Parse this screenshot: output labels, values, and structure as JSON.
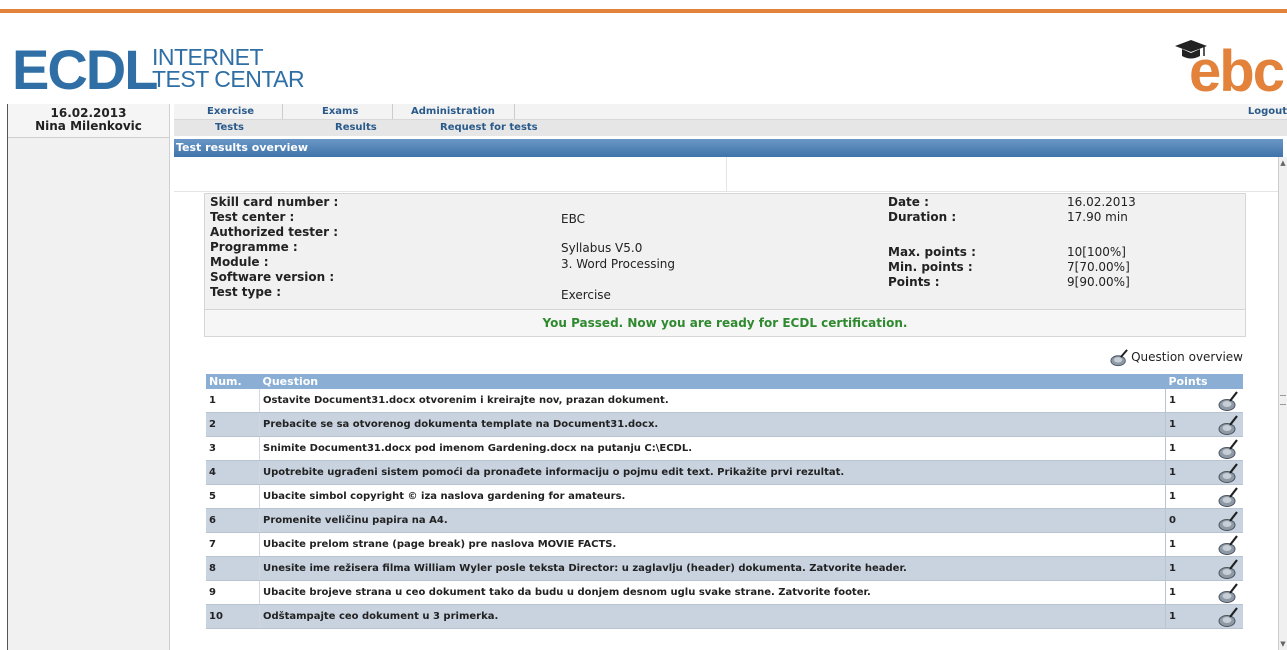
{
  "brand": {
    "left_logo": "ECDL",
    "left_sub1": "INTERNET",
    "left_sub2": "TEST CENTAR",
    "right_logo": "ebc",
    "accent": "#e3823a",
    "blue": "#2f6fa5"
  },
  "sidebar": {
    "date": "16.02.2013",
    "user": "Nina Milenkovic"
  },
  "nav": {
    "row1": [
      "Exercise",
      "Exams",
      "Administration"
    ],
    "logout": "Logout",
    "row2": [
      "Tests",
      "Results",
      "Request for tests"
    ]
  },
  "page_title": "Test results overview",
  "info": {
    "skill_card_label": "Skill card number :",
    "test_center_label": "Test center :",
    "test_center_value": "EBC",
    "authorized_label": "Authorized tester :",
    "programme_label": "Programme :",
    "programme_value": "Syllabus V5.0",
    "module_label": "Module :",
    "module_value": "3. Word Processing",
    "software_label": "Software version :",
    "test_type_label": "Test type :",
    "test_type_value": "Exercise",
    "date_label": "Date :",
    "date_value": "16.02.2013",
    "duration_label": "Duration :",
    "duration_value": "17.90 min",
    "max_label": "Max. points :",
    "max_value": "10[100%]",
    "min_label": "Min. points :",
    "min_value": "7[70.00%]",
    "points_label": "Points :",
    "points_value": "9[90.00%]",
    "passed_message": "You Passed. Now you are ready for ECDL certification."
  },
  "question_overview_label": "Question overview",
  "table": {
    "headers": {
      "num": "Num.",
      "question": "Question",
      "points": "Points"
    },
    "rows": [
      {
        "num": "1",
        "question": "Ostavite Document31.docx otvorenim i kreirajte nov, prazan dokument.",
        "points": "1"
      },
      {
        "num": "2",
        "question": "Prebacite se sa otvorenog dokumenta template na Document31.docx.",
        "points": "1"
      },
      {
        "num": "3",
        "question": "Snimite Document31.docx pod imenom Gardening.docx na putanju C:\\ECDL.",
        "points": "1"
      },
      {
        "num": "4",
        "question": "Upotrebite ugrađeni sistem pomoći da pronađete informaciju o pojmu edit text. Prikažite prvi rezultat.",
        "points": "1"
      },
      {
        "num": "5",
        "question": "Ubacite simbol copyright © iza naslova gardening for amateurs.",
        "points": "1"
      },
      {
        "num": "6",
        "question": "Promenite veličinu papira na A4.",
        "points": "0"
      },
      {
        "num": "7",
        "question": "Ubacite prelom strane (page break) pre naslova MOVIE FACTS.",
        "points": "1"
      },
      {
        "num": "8",
        "question": "Unesite ime režisera filma William Wyler posle teksta Director: u zaglavlju (header) dokumenta. Zatvorite header.",
        "points": "1"
      },
      {
        "num": "9",
        "question": "Ubacite brojeve strana u ceo dokument tako da budu u donjem desnom uglu svake strane. Zatvorite footer.",
        "points": "1"
      },
      {
        "num": "10",
        "question": "Odštampajte ceo dokument u 3 primerka.",
        "points": "1"
      }
    ]
  }
}
